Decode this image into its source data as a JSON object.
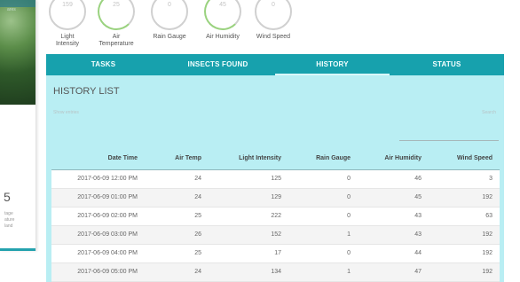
{
  "left_card": {
    "banner_text": "ares",
    "number": "5",
    "lines": [
      "tage",
      "ature",
      "land"
    ]
  },
  "gauges": [
    {
      "value": "159",
      "label": "Light\nIntensity"
    },
    {
      "value": "25",
      "label": "Air\nTemperature"
    },
    {
      "value": "0",
      "label": "Rain Gauge"
    },
    {
      "value": "45",
      "label": "Air Humidity"
    },
    {
      "value": "0",
      "label": "Wind Speed"
    }
  ],
  "tabs": [
    "TASKS",
    "INSECTS FOUND",
    "HISTORY",
    "STATUS"
  ],
  "active_tab": "HISTORY",
  "history": {
    "title": "HISTORY LIST",
    "show_entries": "Show entries",
    "search_label": "Search",
    "columns": [
      "Date Time",
      "Air Temp",
      "Light Intensity",
      "Rain Gauge",
      "Air Humidity",
      "Wind Speed"
    ],
    "rows": [
      [
        "2017-06-09 12:00 PM",
        "24",
        "125",
        "0",
        "46",
        "3"
      ],
      [
        "2017-06-09 01:00 PM",
        "24",
        "129",
        "0",
        "45",
        "192"
      ],
      [
        "2017-06-09 02:00 PM",
        "25",
        "222",
        "0",
        "43",
        "63"
      ],
      [
        "2017-06-09 03:00 PM",
        "26",
        "152",
        "1",
        "43",
        "192"
      ],
      [
        "2017-06-09 04:00 PM",
        "25",
        "17",
        "0",
        "44",
        "192"
      ],
      [
        "2017-06-09 05:00 PM",
        "24",
        "134",
        "1",
        "47",
        "192"
      ]
    ]
  },
  "colors": {
    "accent": "#17a1ad",
    "panel": "#b9eef3",
    "gauge_active": "#9ad27f"
  }
}
